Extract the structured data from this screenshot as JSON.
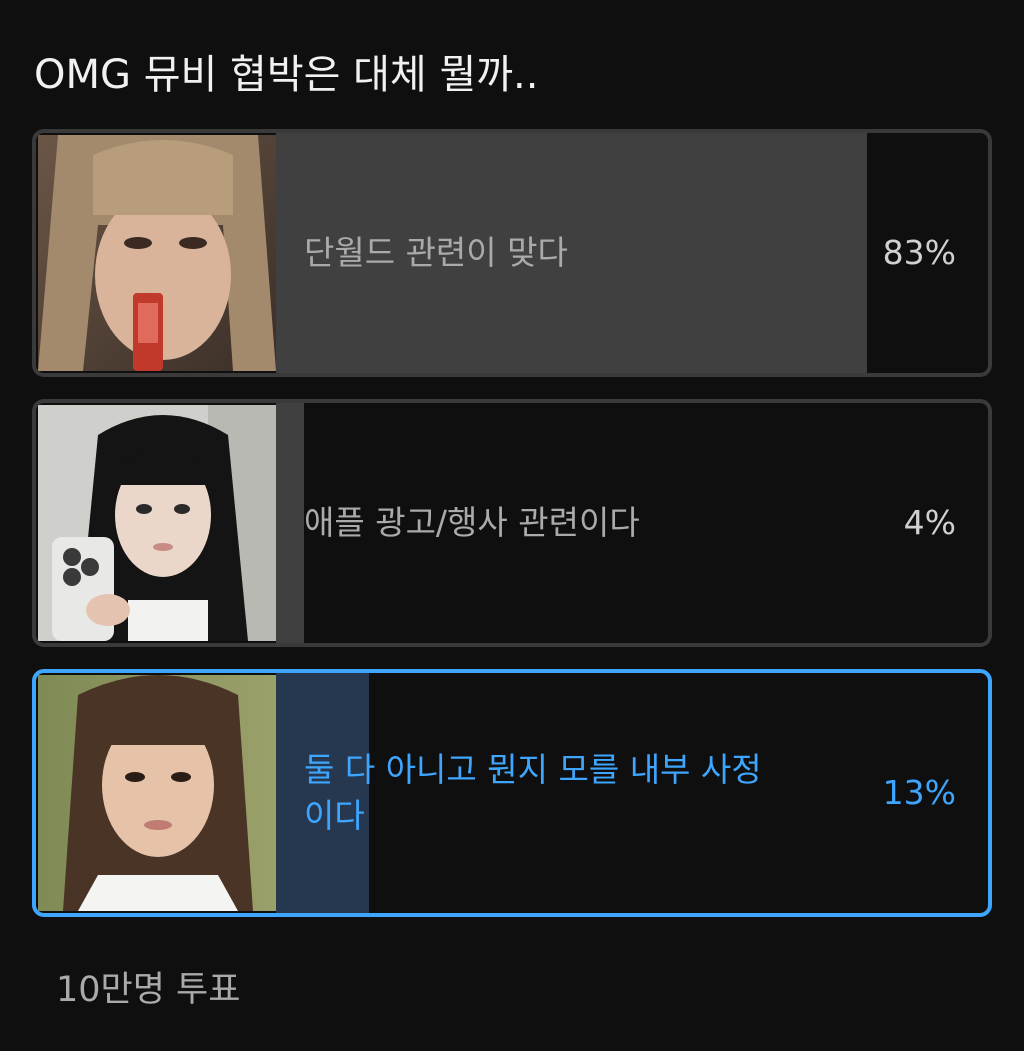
{
  "poll": {
    "question": "OMG 뮤비 협박은 대체 뭘까..",
    "options": [
      {
        "label": "단월드 관련이 맞다",
        "percent_text": "83%",
        "percent": 83,
        "selected": false,
        "thumbnail": "girl-drinking-red-juice-pouch"
      },
      {
        "label": "애플 광고/행사 관련이다",
        "percent_text": "4%",
        "percent": 4,
        "selected": false,
        "thumbnail": "girl-holding-phone-mirror-selfie"
      },
      {
        "label": "둘 다 아니고 뭔지 모를 내부 사정이다",
        "percent_text": "13%",
        "percent": 13,
        "selected": true,
        "thumbnail": "girl-portrait-outdoors"
      }
    ],
    "vote_count": "10만명 투표"
  },
  "colors": {
    "background": "#0f0f0f",
    "option_border": "#3a3a3a",
    "fill": "#404040",
    "selected_accent": "#3ea6ff",
    "selected_fill": "#263850"
  }
}
